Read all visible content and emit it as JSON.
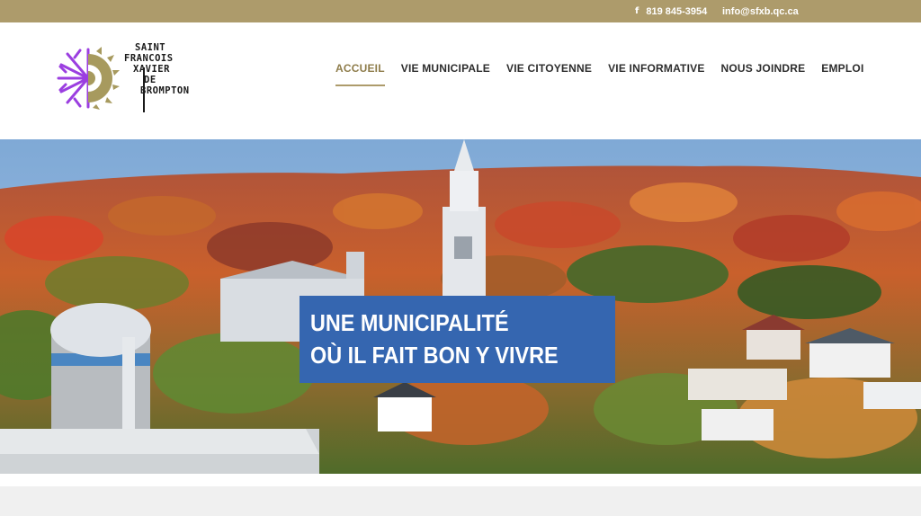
{
  "topbar": {
    "facebook_icon": "facebook-icon",
    "phone": "819 845-3954",
    "email": "info@sfxb.qc.ca",
    "background_color": "#ad9b6b"
  },
  "logo": {
    "line1": "SAINT",
    "line2": "FRANCOIS",
    "line3": "XAVIER",
    "line4": "DE",
    "line5": "BROMPTON",
    "mark_colors": [
      "#9b3ee0",
      "#a79a5e"
    ]
  },
  "nav": {
    "items": [
      {
        "label": "ACCUEIL",
        "active": true
      },
      {
        "label": "VIE MUNICIPALE",
        "active": false
      },
      {
        "label": "VIE CITOYENNE",
        "active": false
      },
      {
        "label": "VIE INFORMATIVE",
        "active": false
      },
      {
        "label": "NOUS JOINDRE",
        "active": false
      },
      {
        "label": "EMPLOI",
        "active": false
      }
    ],
    "active_color": "#8e7c4a"
  },
  "hero": {
    "title_line1": "UNE MUNICIPALITÉ",
    "title_line2": "OÙ IL FAIT BON Y VIVRE",
    "title_bg_color": "#3566b0"
  }
}
